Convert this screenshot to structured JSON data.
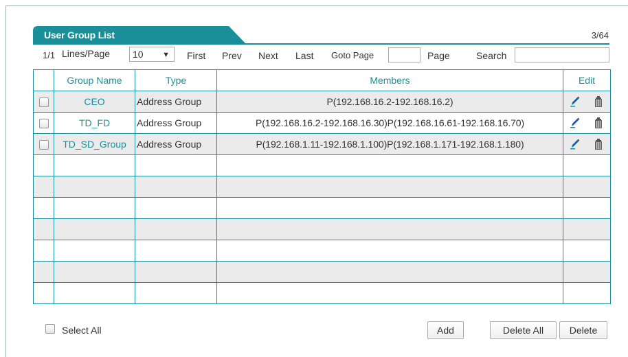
{
  "panel": {
    "title": "User Group List",
    "counter": "3/64"
  },
  "toolbar": {
    "page_indicator": "1/1",
    "lines_label": "Lines/Page",
    "lines_value": "10",
    "first": "First",
    "prev": "Prev",
    "next": "Next",
    "last": "Last",
    "goto": "Goto Page",
    "goto_value": "",
    "page": "Page",
    "search": "Search",
    "search_value": ""
  },
  "table": {
    "headers": {
      "group_name": "Group Name",
      "type": "Type",
      "members": "Members",
      "edit": "Edit"
    },
    "rows": [
      {
        "name": "CEO",
        "type": "Address Group",
        "members": "P(192.168.16.2-192.168.16.2)"
      },
      {
        "name": "TD_FD",
        "type": "Address Group",
        "members": "P(192.168.16.2-192.168.16.30)P(192.168.16.61-192.168.16.70)"
      },
      {
        "name": "TD_SD_Group",
        "type": "Address Group",
        "members": "P(192.168.1.11-192.168.1.100)P(192.168.1.171-192.168.1.180)"
      }
    ]
  },
  "footer": {
    "select_all": "Select All",
    "add": "Add",
    "delete_all": "Delete All",
    "delete": "Delete"
  },
  "colors": {
    "accent": "#1a8f9a",
    "row_alt": "#ebebeb"
  },
  "icons": [
    "edit-icon",
    "trash-icon",
    "dropdown-arrow-icon"
  ]
}
